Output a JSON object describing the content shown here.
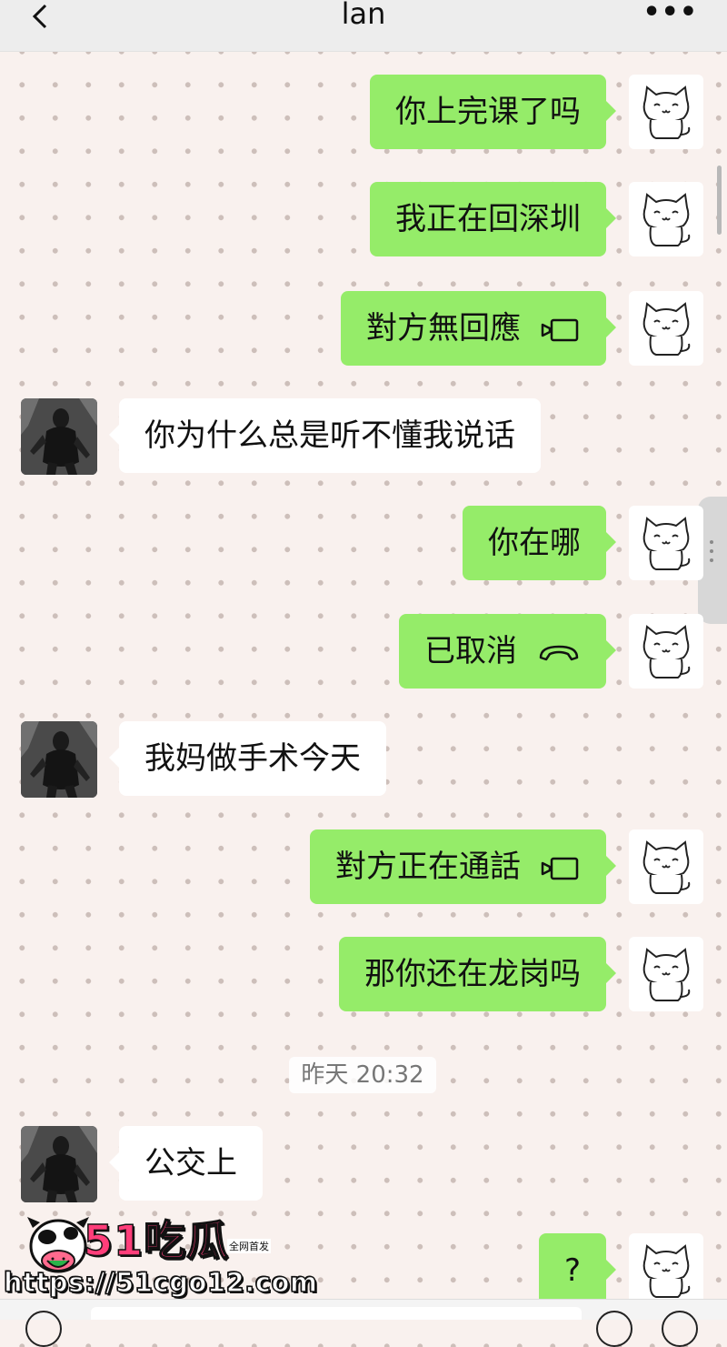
{
  "header": {
    "title": "lan",
    "more": "•••"
  },
  "messages": [
    {
      "side": "out",
      "text": "你上完课了吗"
    },
    {
      "side": "out",
      "text": "我正在回深圳"
    },
    {
      "side": "out",
      "text": "對方無回應",
      "icon": "video-call-icon"
    },
    {
      "side": "in",
      "text": "你为什么总是听不懂我说话"
    },
    {
      "side": "out",
      "text": "你在哪"
    },
    {
      "side": "out",
      "text": "已取消",
      "icon": "phone-hangup-icon"
    },
    {
      "side": "in",
      "text": "我妈做手术今天"
    },
    {
      "side": "out",
      "text": "對方正在通話",
      "icon": "video-call-icon"
    },
    {
      "side": "out",
      "text": "那你还在龙岗吗"
    },
    {
      "side": "in",
      "text": "公交上"
    },
    {
      "side": "out",
      "text": "?"
    }
  ],
  "timestamp": "昨天 20:32",
  "watermark": {
    "brand": "51吃瓜",
    "tag": "全网首发",
    "url": "https://51cgo12.com"
  },
  "colors": {
    "outgoing_bubble": "#95ec69",
    "incoming_bubble": "#ffffff",
    "header_bg": "#ededed",
    "watermark_pink": "#ff3e7a"
  }
}
